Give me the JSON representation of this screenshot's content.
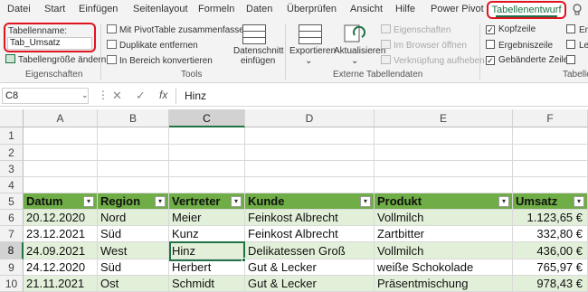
{
  "menu": {
    "tabs": [
      "Datei",
      "Start",
      "Einfügen",
      "Seitenlayout",
      "Formeln",
      "Daten",
      "Überprüfen",
      "Ansicht",
      "Hilfe",
      "Power Pivot",
      "Tabellenentwurf"
    ]
  },
  "ribbon": {
    "table_name_label": "Tabellenname:",
    "table_name_value": "Tab_Umsatz",
    "resize_label": "Tabellengröße ändern",
    "group_properties": "Eigenschaften",
    "pivot_label": "Mit PivotTable zusammenfassen",
    "dedupe_label": "Duplikate entfernen",
    "convert_label": "In Bereich konvertieren",
    "slicer_label_1": "Datenschnitt",
    "slicer_label_2": "einfügen",
    "group_tools": "Tools",
    "export_label": "Exportieren",
    "refresh_label": "Aktualisieren",
    "properties_label": "Eigenschaften",
    "browser_label": "Im Browser öffnen",
    "unlink_label": "Verknüpfung aufheben",
    "group_external": "Externe Tabellendaten",
    "header_row_label": "Kopfzeile",
    "total_row_label": "Ergebniszeile",
    "banded_rows_label": "Gebänderte Zeilen",
    "first_col_partial": "Ers",
    "last_col_partial": "Le",
    "group_style_partial": "Tabelle"
  },
  "formula_bar": {
    "name_box": "C8",
    "fx": "fx",
    "value": "Hinz"
  },
  "columns": [
    "A",
    "B",
    "C",
    "D",
    "E",
    "F"
  ],
  "rows": [
    "1",
    "2",
    "3",
    "4",
    "5",
    "6",
    "7",
    "8",
    "9",
    "10"
  ],
  "table": {
    "headers": [
      "Datum",
      "Region",
      "Vertreter",
      "Kunde",
      "Produkt",
      "Umsatz"
    ],
    "data": [
      [
        "20.12.2020",
        "Nord",
        "Meier",
        "Feinkost Albrecht",
        "Vollmilch",
        "1.123,65 €"
      ],
      [
        "23.12.2021",
        "Süd",
        "Kunz",
        "Feinkost Albrecht",
        "Zartbitter",
        "332,80 €"
      ],
      [
        "24.09.2021",
        "West",
        "Hinz",
        "Delikatessen Groß",
        "Vollmilch",
        "436,00 €"
      ],
      [
        "24.12.2020",
        "Süd",
        "Herbert",
        "Gut & Lecker",
        "weiße Schokolade",
        "765,97 €"
      ],
      [
        "21.11.2021",
        "Ost",
        "Schmidt",
        "Gut & Lecker",
        "Präsentmischung",
        "978,43 €"
      ]
    ]
  },
  "colors": {
    "accent": "#1e7145",
    "highlight": "#e0141e",
    "table_header": "#6fad46",
    "band": "#e2efd9"
  }
}
